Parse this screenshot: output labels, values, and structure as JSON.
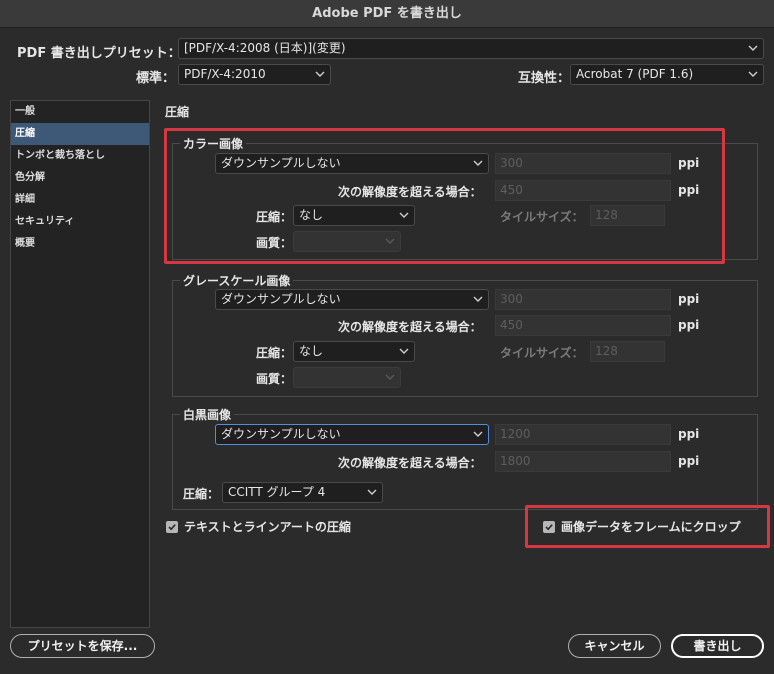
{
  "window": {
    "title": "Adobe PDF を書き出し"
  },
  "header": {
    "preset_label": "PDF 書き出しプリセット：",
    "preset_value": "[PDF/X-4:2008 (日本)](変更)",
    "standard_label": "標準：",
    "standard_value": "PDF/X-4:2010",
    "compat_label": "互換性：",
    "compat_value": "Acrobat 7 (PDF 1.6)"
  },
  "sidebar": {
    "items": [
      {
        "label": "一般"
      },
      {
        "label": "圧縮"
      },
      {
        "label": "トンボと裁ち落とし"
      },
      {
        "label": "色分解"
      },
      {
        "label": "詳細"
      },
      {
        "label": "セキュリティ"
      },
      {
        "label": "概要"
      }
    ]
  },
  "main": {
    "section_title": "圧縮",
    "color": {
      "title": "カラー画像",
      "downsample": "ダウンサンプルしない",
      "ppi_value": "300",
      "ppi_unit": "ppi",
      "above_label": "次の解像度を超える場合：",
      "above_value": "450",
      "above_unit": "ppi",
      "compression_label": "圧縮：",
      "compression_value": "なし",
      "tile_label": "タイルサイズ：",
      "tile_value": "128",
      "quality_label": "画質："
    },
    "gray": {
      "title": "グレースケール画像",
      "downsample": "ダウンサンプルしない",
      "ppi_value": "300",
      "ppi_unit": "ppi",
      "above_label": "次の解像度を超える場合：",
      "above_value": "450",
      "above_unit": "ppi",
      "compression_label": "圧縮：",
      "compression_value": "なし",
      "tile_label": "タイルサイズ：",
      "tile_value": "128",
      "quality_label": "画質："
    },
    "mono": {
      "title": "白黒画像",
      "downsample": "ダウンサンプルしない",
      "ppi_value": "1200",
      "ppi_unit": "ppi",
      "above_label": "次の解像度を超える場合：",
      "above_value": "1800",
      "above_unit": "ppi",
      "compression_label": "圧縮：",
      "compression_value": "CCITT グループ 4"
    },
    "compress_text": {
      "label": "テキストとラインアートの圧縮",
      "checked": true
    },
    "crop_image": {
      "label": "画像データをフレームにクロップ",
      "checked": true
    }
  },
  "footer": {
    "save_preset": "プリセットを保存...",
    "cancel": "キャンセル",
    "export": "書き出し"
  },
  "colors": {
    "highlight": "#d63843",
    "selection": "#3e5878",
    "focus": "#4e8fe0"
  }
}
